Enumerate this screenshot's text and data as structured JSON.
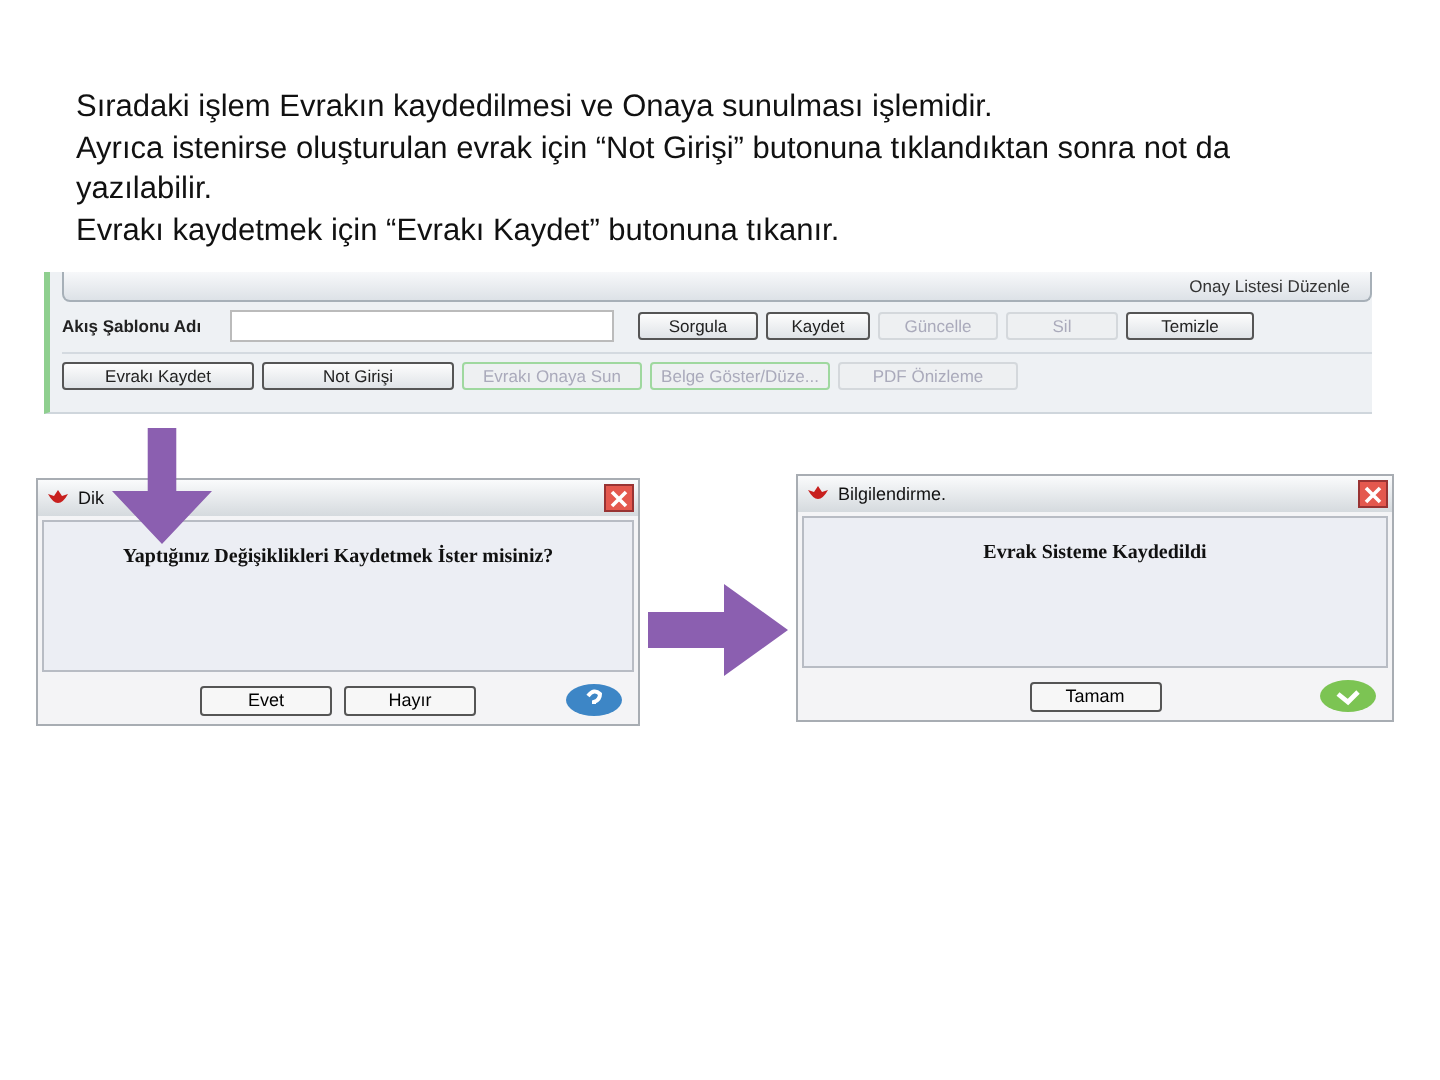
{
  "paragraphs": [
    "Sıradaki işlem Evrakın kaydedilmesi ve Onaya sunulması işlemidir.",
    "Ayrıca istenirse oluşturulan evrak için “Not Girişi” butonuna tıklandıktan sonra not da yazılabilir.",
    "Evrakı kaydetmek için “Evrakı Kaydet” butonuna tıkanır."
  ],
  "toolbar": {
    "link": "Onay Listesi Düzenle",
    "field_label": "Akış Şablonu Adı",
    "top_buttons": [
      {
        "label": "Sorgula",
        "kind": "normal"
      },
      {
        "label": "Kaydet",
        "kind": "normal"
      },
      {
        "label": "Güncelle",
        "kind": "disabled"
      },
      {
        "label": "Sil",
        "kind": "disabled"
      },
      {
        "label": "Temizle",
        "kind": "normal"
      }
    ],
    "bottom_buttons": [
      {
        "label": "Evrakı Kaydet",
        "kind": "normal"
      },
      {
        "label": "Not Girişi",
        "kind": "normal"
      },
      {
        "label": "Evrakı Onaya Sun",
        "kind": "highlighted"
      },
      {
        "label": "Belge Göster/Düze...",
        "kind": "highlighted"
      },
      {
        "label": "PDF Önizleme",
        "kind": "disabled"
      }
    ]
  },
  "dialogs": [
    {
      "title": "Dik",
      "message": "Yaptığınız Değişiklikleri Kaydetmek İster misiniz?",
      "buttons": [
        "Evet",
        "Hayır"
      ],
      "kind": "question"
    },
    {
      "title": "Bilgilendirme.",
      "message": "Evrak Sisteme Kaydedildi",
      "buttons": [
        "Tamam"
      ],
      "kind": "info"
    }
  ]
}
